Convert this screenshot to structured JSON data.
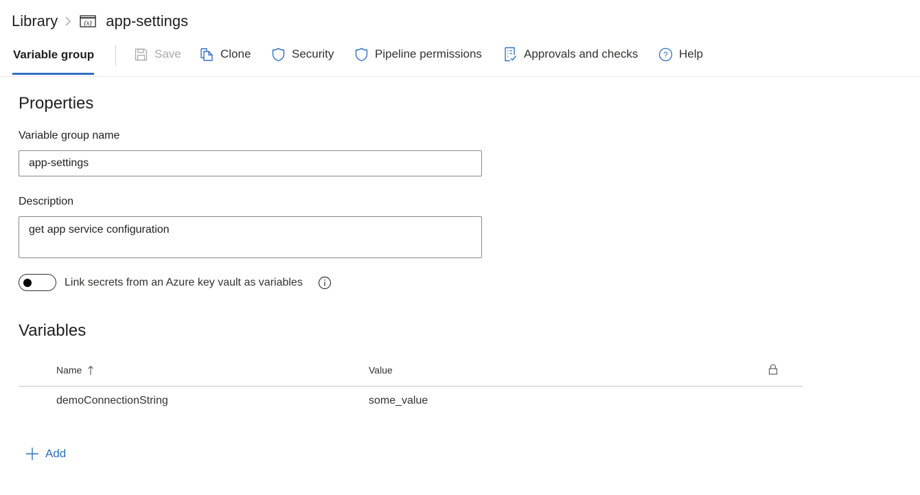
{
  "breadcrumb": {
    "root": "Library",
    "separator_icon": "chevron-right-icon",
    "item_icon": "variable-group-icon",
    "current": "app-settings"
  },
  "toolbar": {
    "active_tab": "Variable group",
    "buttons": [
      {
        "label": "Save",
        "icon": "save-icon",
        "disabled": true
      },
      {
        "label": "Clone",
        "icon": "clone-icon",
        "disabled": false
      },
      {
        "label": "Security",
        "icon": "shield-icon",
        "disabled": false
      },
      {
        "label": "Pipeline permissions",
        "icon": "shield-icon",
        "disabled": false
      },
      {
        "label": "Approvals and checks",
        "icon": "checklist-icon",
        "disabled": false
      },
      {
        "label": "Help",
        "icon": "help-icon",
        "disabled": false
      }
    ]
  },
  "properties": {
    "title": "Properties",
    "name_label": "Variable group name",
    "name_value": "app-settings",
    "description_label": "Description",
    "description_value": "get app service configuration",
    "keyvault_toggle_label": "Link secrets from an Azure key vault as variables",
    "keyvault_toggle_on": false
  },
  "variables": {
    "title": "Variables",
    "columns": [
      {
        "label": "Name",
        "sort": "ascending",
        "sort_icon": "arrow-up-icon"
      },
      {
        "label": "Value"
      },
      {
        "label": "",
        "icon": "lock-icon"
      }
    ],
    "rows": [
      {
        "name": "demoConnectionString",
        "value": "some_value"
      }
    ],
    "add_label": "Add"
  },
  "colors": {
    "accent": "#2f6fbf",
    "text": "#201f1e",
    "disabled": "#a8a8a8",
    "border": "#8a8886"
  }
}
